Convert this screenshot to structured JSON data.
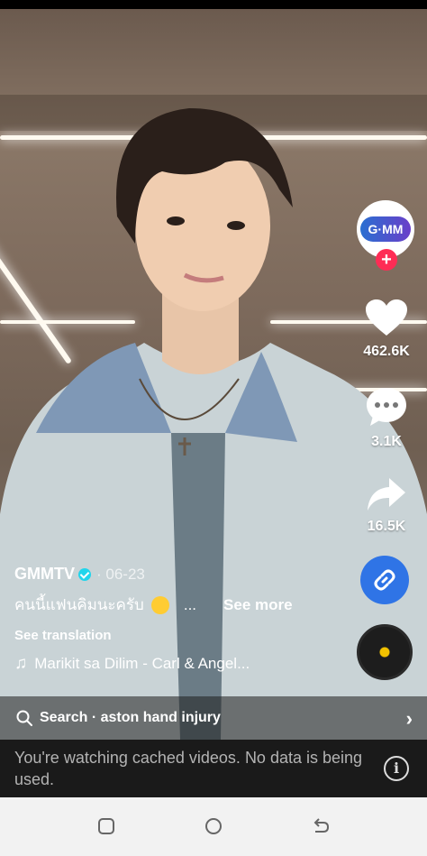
{
  "rail": {
    "avatar_logo": "G·MM",
    "follow_symbol": "+",
    "likes": "462.6K",
    "comments": "3.1K",
    "shares": "16.5K"
  },
  "caption": {
    "author": "GMMTV",
    "date": "· 06-23",
    "description": "คนนี้แฟนคิมนะครับ",
    "ellipsis": "...",
    "see_more": "See more",
    "see_translation": "See translation",
    "music_note": "♫",
    "music": "Marikit sa Dilim - Carl & Angel..."
  },
  "search": {
    "text": "Search · aston hand injury",
    "chevron": "›"
  },
  "notice": {
    "text": "You're watching cached videos. No data is being used.",
    "info_symbol": "i"
  },
  "colors": {
    "follow": "#fe2c55",
    "link_button": "#2f74e6",
    "verified": "#20d5ec"
  },
  "icons": [
    "heart-icon",
    "comment-icon",
    "share-icon",
    "link-icon",
    "music-disc-icon",
    "search-icon",
    "info-icon",
    "recents-icon",
    "home-icon",
    "back-icon"
  ]
}
